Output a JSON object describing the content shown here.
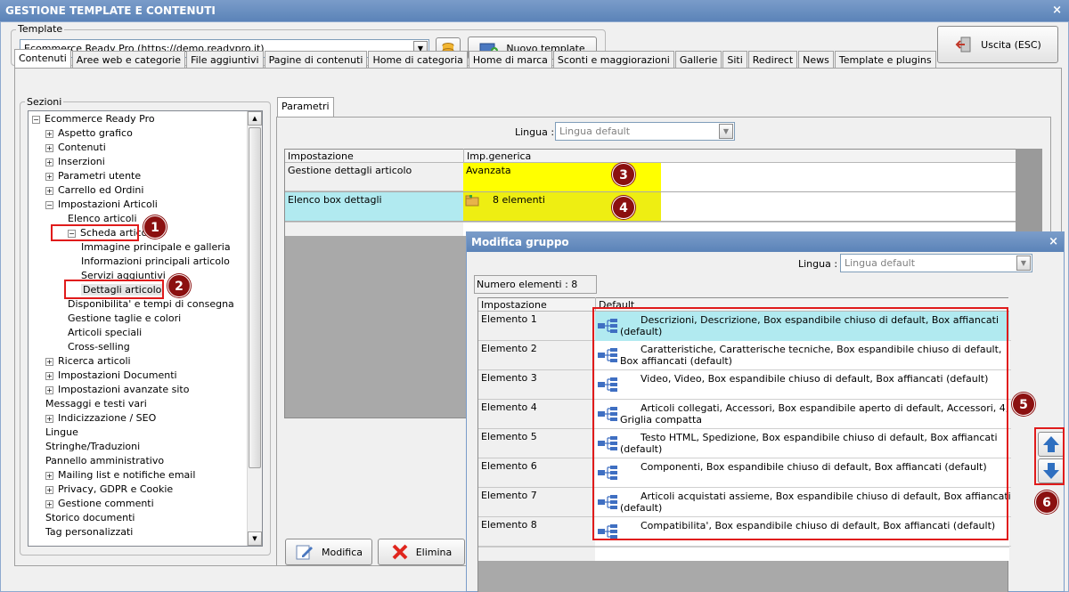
{
  "window": {
    "title": "GESTIONE TEMPLATE E CONTENUTI",
    "close": "×"
  },
  "template": {
    "group_label": "Template",
    "selected": "Ecommerce Ready Pro (https://demo.readypro.it)",
    "new_button": "Nuovo template",
    "exit_button": "Uscita (ESC)"
  },
  "tabs": [
    "Contenuti",
    "Aree web e categorie",
    "File aggiuntivi",
    "Pagine di contenuti",
    "Home di categoria",
    "Home di marca",
    "Sconti e maggiorazioni",
    "Gallerie",
    "Siti",
    "Redirect",
    "News",
    "Template e plugins"
  ],
  "sections": {
    "label": "Sezioni",
    "items": [
      {
        "label": "Ecommerce Ready Pro",
        "level": 0,
        "exp": "−"
      },
      {
        "label": "Aspetto grafico",
        "level": 1,
        "exp": "+"
      },
      {
        "label": "Contenuti",
        "level": 1,
        "exp": "+"
      },
      {
        "label": "Inserzioni",
        "level": 1,
        "exp": "+"
      },
      {
        "label": "Parametri utente",
        "level": 1,
        "exp": "+"
      },
      {
        "label": "Carrello ed Ordini",
        "level": 1,
        "exp": "+"
      },
      {
        "label": "Impostazioni Articoli",
        "level": 1,
        "exp": "−"
      },
      {
        "label": "Elenco articoli",
        "level": 2,
        "exp": ""
      },
      {
        "label": "Scheda articolo",
        "level": 2,
        "exp": "−"
      },
      {
        "label": "Immagine principale e galleria",
        "level": 3,
        "exp": ""
      },
      {
        "label": "Informazioni principali articolo",
        "level": 3,
        "exp": ""
      },
      {
        "label": "Servizi aggiuntivi",
        "level": 3,
        "exp": ""
      },
      {
        "label": "Dettagli articolo",
        "level": 3,
        "exp": "",
        "selected": true
      },
      {
        "label": "Disponibilita' e tempi di consegna",
        "level": 2,
        "exp": ""
      },
      {
        "label": "Gestione taglie e colori",
        "level": 2,
        "exp": ""
      },
      {
        "label": "Articoli speciali",
        "level": 2,
        "exp": ""
      },
      {
        "label": "Cross-selling",
        "level": 2,
        "exp": ""
      },
      {
        "label": "Ricerca articoli",
        "level": 1,
        "exp": "+"
      },
      {
        "label": "Impostazioni Documenti",
        "level": 1,
        "exp": "+"
      },
      {
        "label": "Impostazioni avanzate sito",
        "level": 1,
        "exp": "+"
      },
      {
        "label": "Messaggi e testi vari",
        "level": 1,
        "exp": ""
      },
      {
        "label": "Indicizzazione / SEO",
        "level": 1,
        "exp": "+"
      },
      {
        "label": "Lingue",
        "level": 1,
        "exp": ""
      },
      {
        "label": "Stringhe/Traduzioni",
        "level": 1,
        "exp": ""
      },
      {
        "label": "Pannello amministrativo",
        "level": 1,
        "exp": ""
      },
      {
        "label": "Mailing list e notifiche email",
        "level": 1,
        "exp": "+"
      },
      {
        "label": "Privacy, GDPR e Cookie",
        "level": 1,
        "exp": "+"
      },
      {
        "label": "Gestione commenti",
        "level": 1,
        "exp": "+"
      },
      {
        "label": "Storico documenti",
        "level": 1,
        "exp": ""
      },
      {
        "label": "Tag personalizzati",
        "level": 1,
        "exp": ""
      }
    ]
  },
  "parametri": {
    "tab": "Parametri",
    "lingua_label": "Lingua :",
    "lingua_value": "Lingua default",
    "col_setting": "Impostazione",
    "col_value": "Imp.generica",
    "rows": [
      {
        "setting": "Gestione dettagli articolo",
        "value": "Avanzata"
      },
      {
        "setting": "Elenco box dettagli",
        "value": "8 elementi"
      }
    ],
    "modifica_button": "Modifica",
    "elimina_button": "Elimina"
  },
  "dialog": {
    "title": "Modifica gruppo",
    "lingua_label": "Lingua :",
    "lingua_value": "Lingua default",
    "count": "Numero elementi : 8",
    "col_setting": "Impostazione",
    "col_default": "Default",
    "elements": [
      {
        "name": "Elemento 1",
        "value": "Descrizioni, Descrizione, Box espandibile chiuso di default, Box affiancati (default)"
      },
      {
        "name": "Elemento 2",
        "value": "Caratteristiche, Caratterische tecniche, Box espandibile chiuso di default, Box affiancati (default)"
      },
      {
        "name": "Elemento 3",
        "value": "Video, Video, Box espandibile chiuso di default, Box affiancati (default)"
      },
      {
        "name": "Elemento 4",
        "value": "Articoli collegati, Accessori, Box espandibile aperto di default, Accessori, 4, Griglia compatta"
      },
      {
        "name": "Elemento 5",
        "value": "Testo HTML, Spedizione, Box espandibile chiuso di default, Box affiancati (default)"
      },
      {
        "name": "Elemento 6",
        "value": "Componenti, Box espandibile chiuso di default, Box affiancati (default)"
      },
      {
        "name": "Elemento 7",
        "value": "Articoli acquistati assieme, Box espandibile chiuso di default, Box affiancati (default)"
      },
      {
        "name": "Elemento 8",
        "value": "Compatibilita', Box espandibile chiuso di default, Box affiancati (default)"
      }
    ]
  },
  "badges": [
    "1",
    "2",
    "3",
    "4",
    "5",
    "6"
  ],
  "colors": {
    "highlight_yellow": "#ffff00",
    "highlight_cyan": "#b1eaf0",
    "annotation_red": "#e01b1b",
    "badge": "#8b1010",
    "arrow_blue": "#2f6fc0"
  }
}
